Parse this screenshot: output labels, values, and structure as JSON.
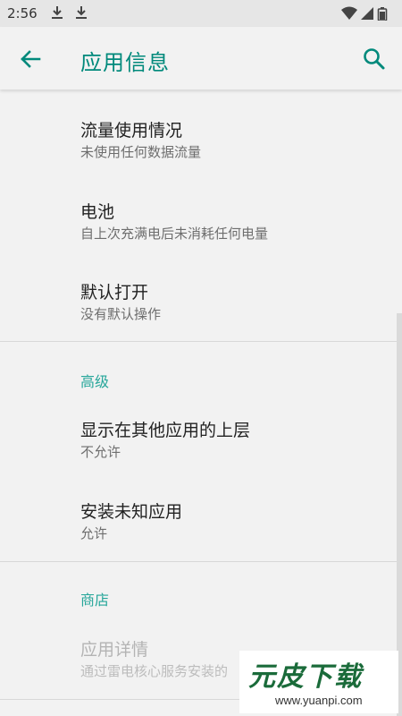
{
  "status_bar": {
    "time": "2:56",
    "icons": [
      "download-icon",
      "download-icon",
      "wifi-icon",
      "signal-icon",
      "battery-icon"
    ]
  },
  "app_bar": {
    "title": "应用信息",
    "back_icon": "arrow-back-icon",
    "search_icon": "search-icon"
  },
  "list": {
    "data_usage": {
      "title": "流量使用情况",
      "subtitle": "未使用任何数据流量"
    },
    "battery": {
      "title": "电池",
      "subtitle": "自上次充满电后未消耗任何电量"
    },
    "open_by_default": {
      "title": "默认打开",
      "subtitle": "没有默认操作"
    },
    "advanced_header": "高级",
    "display_over": {
      "title": "显示在其他应用的上层",
      "subtitle": "不允许"
    },
    "install_unknown": {
      "title": "安装未知应用",
      "subtitle": "允许"
    },
    "store_header": "商店",
    "app_details": {
      "title": "应用详情",
      "subtitle": "通过雷电核心服务安装的"
    }
  },
  "watermark": {
    "logo_text": "元皮下载",
    "url": "www.yuanpi.com"
  },
  "colors": {
    "accent": "#00897b",
    "section_header": "#26a69a",
    "background": "#f2f2f2",
    "status_bar": "#e6e6e6"
  }
}
